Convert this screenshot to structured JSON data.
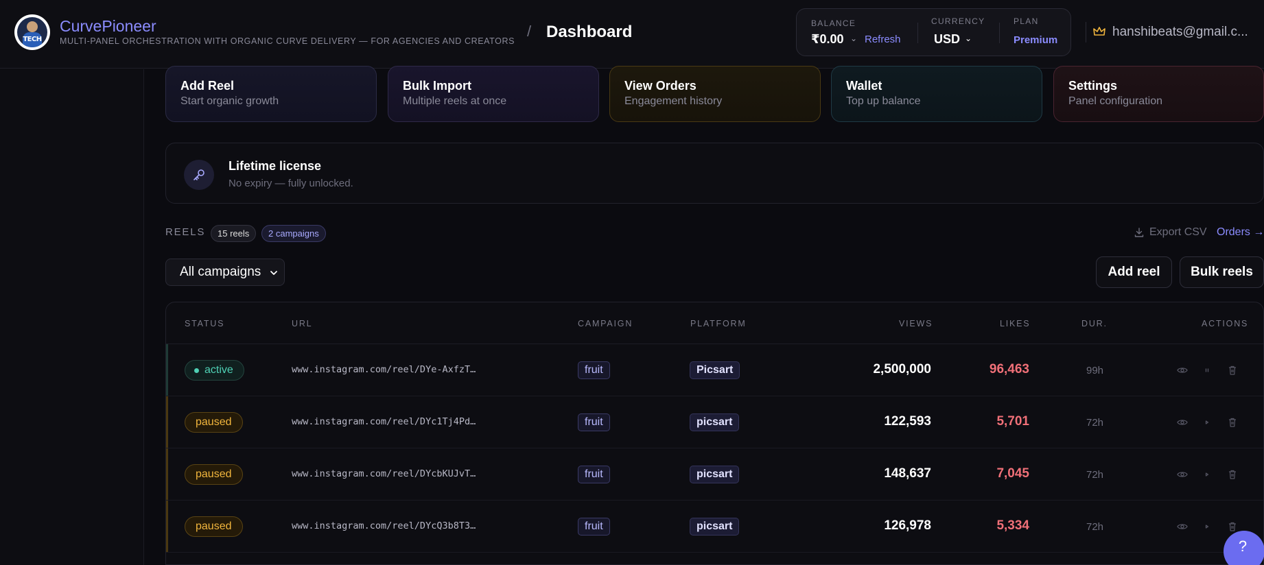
{
  "header": {
    "app_name": "CurvePioneer",
    "tagline": "MULTI-PANEL ORCHESTRATION WITH ORGANIC CURVE DELIVERY — FOR AGENCIES AND CREATORS",
    "breadcrumb_sep": "/",
    "page_title": "Dashboard",
    "logo_text": "TECH",
    "balance": {
      "balance_label": "BALANCE",
      "balance_value": "₹0.00",
      "balance_chevron": "⌄",
      "refresh_label": "Refresh",
      "currency_label": "CURRENCY",
      "currency_value": "USD",
      "currency_chevron": "⌄",
      "plan_label": "PLAN",
      "plan_value": "Premium"
    },
    "user_email": "hanshibeats@gmail.c..."
  },
  "quick_actions": [
    {
      "title": "Add Reel",
      "subtitle": "Start organic growth"
    },
    {
      "title": "Bulk Import",
      "subtitle": "Multiple reels at once"
    },
    {
      "title": "View Orders",
      "subtitle": "Engagement history"
    },
    {
      "title": "Wallet",
      "subtitle": "Top up balance"
    },
    {
      "title": "Settings",
      "subtitle": "Panel configuration"
    }
  ],
  "license": {
    "title": "Lifetime license",
    "subtitle": "No expiry — fully unlocked."
  },
  "reels": {
    "label": "REELS",
    "reel_count": "15 reels",
    "campaign_count": "2 campaigns",
    "export_label": "Export CSV",
    "orders_link": "Orders →",
    "filter_value": "All campaigns",
    "add_reel_label": "Add reel",
    "bulk_reels_label": "Bulk reels",
    "columns": [
      "STATUS",
      "URL",
      "CAMPAIGN",
      "PLATFORM",
      "VIEWS",
      "LIKES",
      "DUR.",
      "ACTIONS"
    ],
    "rows": [
      {
        "status": "active",
        "url": "www.instagram.com/reel/DYe-AxfzT…",
        "campaign": "fruit",
        "platform": "Picsart",
        "views": "2,500,000",
        "likes": "96,463",
        "dur": "99h"
      },
      {
        "status": "paused",
        "url": "www.instagram.com/reel/DYc1Tj4Pd…",
        "campaign": "fruit",
        "platform": "picsart",
        "views": "122,593",
        "likes": "5,701",
        "dur": "72h"
      },
      {
        "status": "paused",
        "url": "www.instagram.com/reel/DYcbKUJvT…",
        "campaign": "fruit",
        "platform": "picsart",
        "views": "148,637",
        "likes": "7,045",
        "dur": "72h"
      },
      {
        "status": "paused",
        "url": "www.instagram.com/reel/DYcQ3b8T3…",
        "campaign": "fruit",
        "platform": "picsart",
        "views": "126,978",
        "likes": "5,334",
        "dur": "72h"
      }
    ]
  },
  "help": {
    "label": "?"
  },
  "colors": {
    "accent": "#8b8cff",
    "active": "#4fd1b5",
    "paused": "#f2b63d",
    "likes": "#f07078",
    "background": "#0b0b10"
  }
}
